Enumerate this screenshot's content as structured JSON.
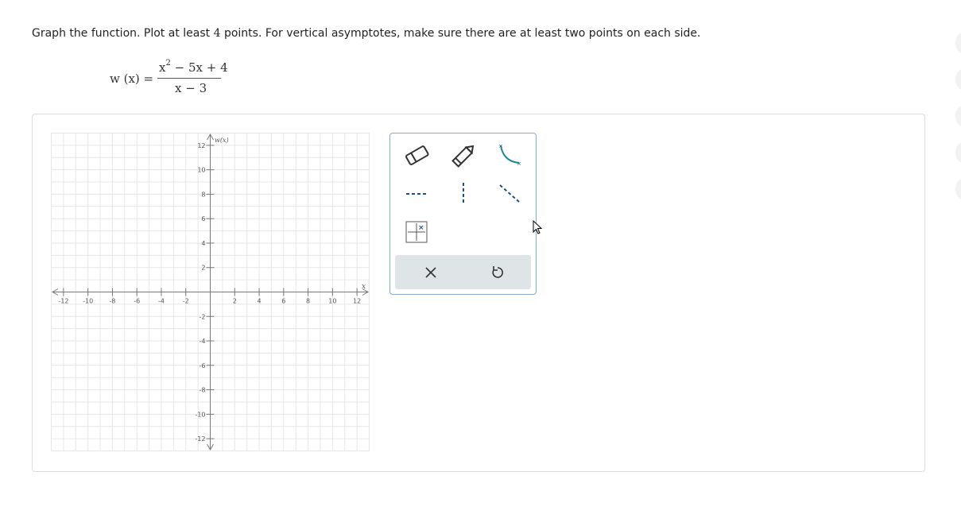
{
  "question": {
    "prompt_before": "Graph the function. Plot at least ",
    "points_required": "4",
    "prompt_after": " points. For vertical asymptotes, make sure there are at least two points on each side."
  },
  "formula": {
    "lhs": "w (x) =",
    "numerator_base": "x",
    "numerator_exp": "2",
    "numerator_rest": "− 5x + 4",
    "denominator": "x − 3"
  },
  "graph": {
    "x_axis_label": "x",
    "y_axis_label": "w(x)",
    "x_min": -13,
    "x_max": 13,
    "y_min": -13,
    "y_max": 13,
    "x_tick_labels": [
      "-12",
      "-10",
      "-8",
      "-6",
      "-4",
      "-2",
      "2",
      "4",
      "6",
      "8",
      "10",
      "12"
    ],
    "x_tick_values": [
      -12,
      -10,
      -8,
      -6,
      -4,
      -2,
      2,
      4,
      6,
      8,
      10,
      12
    ],
    "y_tick_labels": [
      "12",
      "10",
      "8",
      "6",
      "4",
      "2",
      "-2",
      "-4",
      "-6",
      "-8",
      "-10",
      "-12"
    ],
    "y_tick_values": [
      12,
      10,
      8,
      6,
      4,
      2,
      -2,
      -4,
      -6,
      -8,
      -10,
      -12
    ],
    "grid": true
  },
  "tools": {
    "items": [
      "eraser-icon",
      "pencil-icon",
      "curve-tool-icon",
      "horizontal-asymptote-icon",
      "vertical-asymptote-icon",
      "oblique-asymptote-icon",
      "point-grid-icon"
    ],
    "actions": [
      "clear-icon",
      "undo-icon"
    ],
    "accent_color": "#1d8a8f"
  }
}
